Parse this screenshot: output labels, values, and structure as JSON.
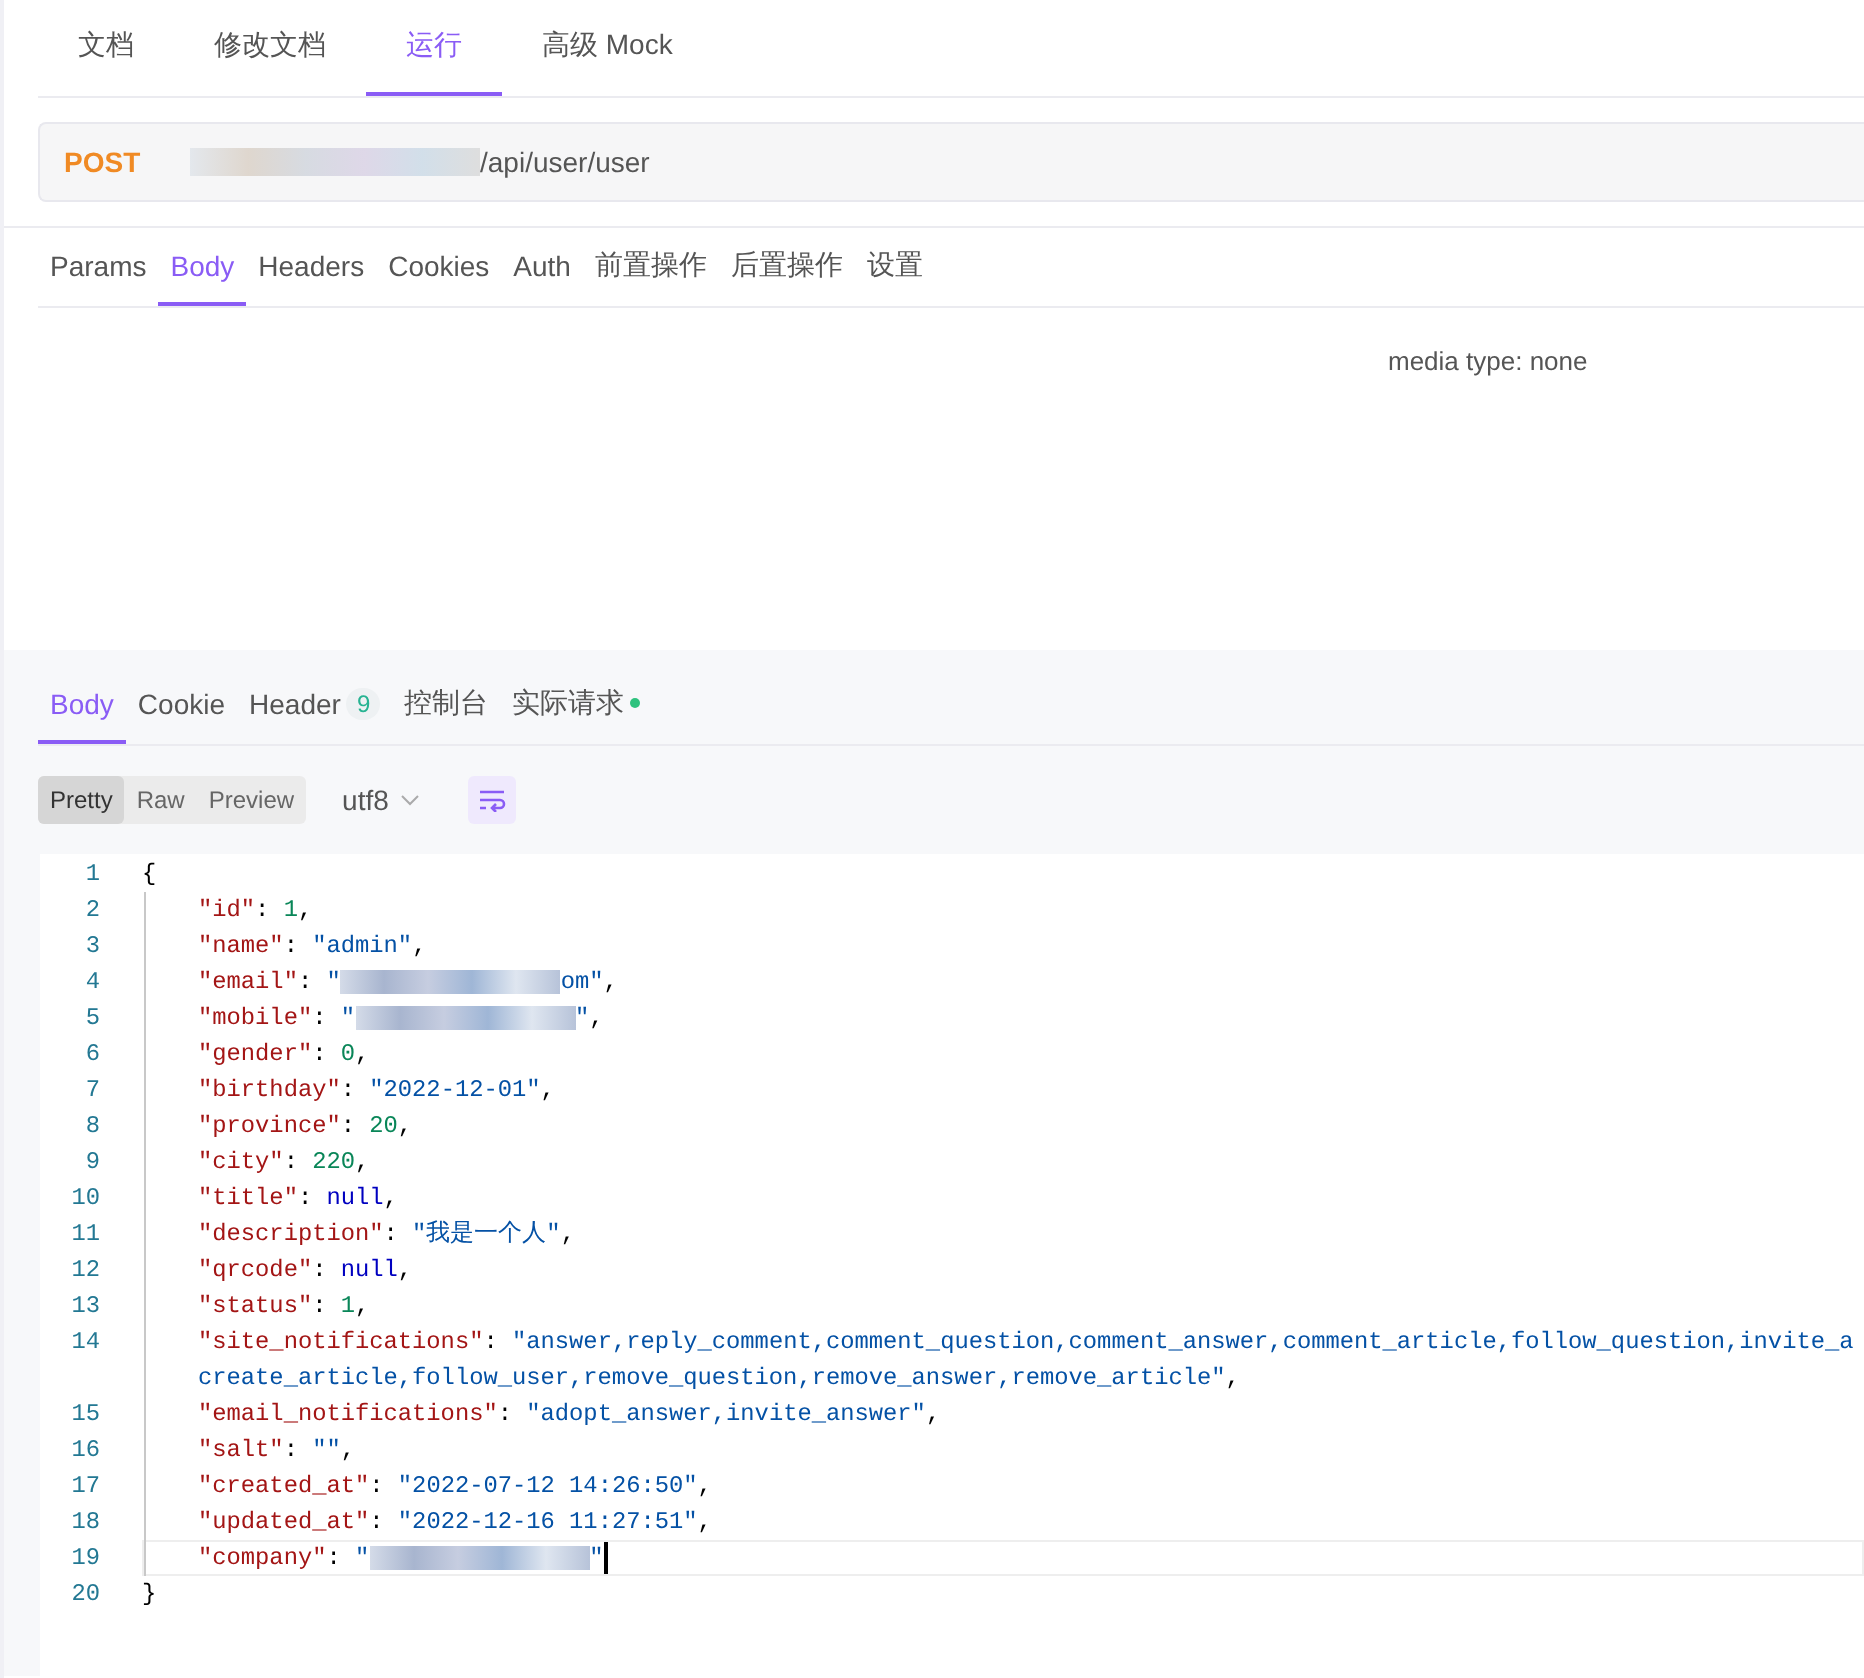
{
  "doc_tabs": [
    {
      "label": "文档",
      "selected": false
    },
    {
      "label": "修改文档",
      "selected": false
    },
    {
      "label": "运行",
      "selected": true
    },
    {
      "label": "高级 Mock",
      "selected": false
    }
  ],
  "request": {
    "method": "POST",
    "url_path": "/api/user/user"
  },
  "param_tabs": [
    {
      "label": "Params",
      "selected": false
    },
    {
      "label": "Body",
      "selected": true
    },
    {
      "label": "Headers",
      "selected": false
    },
    {
      "label": "Cookies",
      "selected": false
    },
    {
      "label": "Auth",
      "selected": false
    },
    {
      "label": "前置操作",
      "selected": false
    },
    {
      "label": "后置操作",
      "selected": false
    },
    {
      "label": "设置",
      "selected": false
    }
  ],
  "body_panel": {
    "media_type": "media type: none"
  },
  "response_tabs": [
    {
      "label": "Body",
      "selected": true,
      "dot": false
    },
    {
      "label": "Cookie",
      "selected": false,
      "dot": false
    },
    {
      "label": "Header",
      "selected": false,
      "badge": "9",
      "dot": false
    },
    {
      "label": "控制台",
      "selected": false,
      "dot": false
    },
    {
      "label": "实际请求",
      "selected": false,
      "dot": true
    }
  ],
  "view_modes": [
    {
      "label": "Pretty",
      "selected": true
    },
    {
      "label": "Raw",
      "selected": false
    },
    {
      "label": "Preview",
      "selected": false
    }
  ],
  "encoding": "utf8",
  "word_wrap": {
    "on": true
  },
  "code_lines": [
    {
      "number": "1",
      "indented": false,
      "current": false,
      "tokens": [
        {
          "kind": "brace",
          "text": "{"
        }
      ]
    },
    {
      "number": "2",
      "indented": true,
      "current": false,
      "tokens": [
        {
          "kind": "key",
          "text": "\"id\""
        },
        {
          "kind": "punct",
          "text": ": "
        },
        {
          "kind": "number",
          "text": "1"
        },
        {
          "kind": "punct",
          "text": ","
        }
      ]
    },
    {
      "number": "3",
      "indented": true,
      "current": false,
      "tokens": [
        {
          "kind": "key",
          "text": "\"name\""
        },
        {
          "kind": "punct",
          "text": ": "
        },
        {
          "kind": "string",
          "text": "\"admin\""
        },
        {
          "kind": "punct",
          "text": ","
        }
      ]
    },
    {
      "number": "4",
      "indented": true,
      "current": false,
      "tokens": [
        {
          "kind": "key",
          "text": "\"email\""
        },
        {
          "kind": "punct",
          "text": ": "
        },
        {
          "kind": "string",
          "text": "\""
        },
        {
          "kind": "redacted"
        },
        {
          "kind": "string",
          "text": "om\""
        },
        {
          "kind": "punct",
          "text": ","
        }
      ]
    },
    {
      "number": "5",
      "indented": true,
      "current": false,
      "tokens": [
        {
          "kind": "key",
          "text": "\"mobile\""
        },
        {
          "kind": "punct",
          "text": ": "
        },
        {
          "kind": "string",
          "text": "\""
        },
        {
          "kind": "redacted"
        },
        {
          "kind": "string",
          "text": "\""
        },
        {
          "kind": "punct",
          "text": ","
        }
      ]
    },
    {
      "number": "6",
      "indented": true,
      "current": false,
      "tokens": [
        {
          "kind": "key",
          "text": "\"gender\""
        },
        {
          "kind": "punct",
          "text": ": "
        },
        {
          "kind": "number",
          "text": "0"
        },
        {
          "kind": "punct",
          "text": ","
        }
      ]
    },
    {
      "number": "7",
      "indented": true,
      "current": false,
      "tokens": [
        {
          "kind": "key",
          "text": "\"birthday\""
        },
        {
          "kind": "punct",
          "text": ": "
        },
        {
          "kind": "string",
          "text": "\"2022-12-01\""
        },
        {
          "kind": "punct",
          "text": ","
        }
      ]
    },
    {
      "number": "8",
      "indented": true,
      "current": false,
      "tokens": [
        {
          "kind": "key",
          "text": "\"province\""
        },
        {
          "kind": "punct",
          "text": ": "
        },
        {
          "kind": "number",
          "text": "20"
        },
        {
          "kind": "punct",
          "text": ","
        }
      ]
    },
    {
      "number": "9",
      "indented": true,
      "current": false,
      "tokens": [
        {
          "kind": "key",
          "text": "\"city\""
        },
        {
          "kind": "punct",
          "text": ": "
        },
        {
          "kind": "number",
          "text": "220"
        },
        {
          "kind": "punct",
          "text": ","
        }
      ]
    },
    {
      "number": "10",
      "indented": true,
      "current": false,
      "tokens": [
        {
          "kind": "key",
          "text": "\"title\""
        },
        {
          "kind": "punct",
          "text": ": "
        },
        {
          "kind": "null",
          "text": "null"
        },
        {
          "kind": "punct",
          "text": ","
        }
      ]
    },
    {
      "number": "11",
      "indented": true,
      "current": false,
      "tokens": [
        {
          "kind": "key",
          "text": "\"description\""
        },
        {
          "kind": "punct",
          "text": ": "
        },
        {
          "kind": "string",
          "text": "\"我是一个人\""
        },
        {
          "kind": "punct",
          "text": ","
        }
      ]
    },
    {
      "number": "12",
      "indented": true,
      "current": false,
      "tokens": [
        {
          "kind": "key",
          "text": "\"qrcode\""
        },
        {
          "kind": "punct",
          "text": ": "
        },
        {
          "kind": "null",
          "text": "null"
        },
        {
          "kind": "punct",
          "text": ","
        }
      ]
    },
    {
      "number": "13",
      "indented": true,
      "current": false,
      "tokens": [
        {
          "kind": "key",
          "text": "\"status\""
        },
        {
          "kind": "punct",
          "text": ": "
        },
        {
          "kind": "number",
          "text": "1"
        },
        {
          "kind": "punct",
          "text": ","
        }
      ]
    },
    {
      "number": "14",
      "indented": true,
      "current": false,
      "tokens": [
        {
          "kind": "key",
          "text": "\"site_notifications\""
        },
        {
          "kind": "punct",
          "text": ": "
        },
        {
          "kind": "string",
          "text": "\"answer,reply_comment,comment_question,comment_answer,comment_article,follow_question,invite_a"
        }
      ]
    },
    {
      "indented": true,
      "current": false,
      "tokens": [
        {
          "kind": "string",
          "text": "create_article,follow_user,remove_question,remove_answer,remove_article\""
        },
        {
          "kind": "punct",
          "text": ","
        }
      ]
    },
    {
      "number": "15",
      "indented": true,
      "current": false,
      "tokens": [
        {
          "kind": "key",
          "text": "\"email_notifications\""
        },
        {
          "kind": "punct",
          "text": ": "
        },
        {
          "kind": "string",
          "text": "\"adopt_answer,invite_answer\""
        },
        {
          "kind": "punct",
          "text": ","
        }
      ]
    },
    {
      "number": "16",
      "indented": true,
      "current": false,
      "tokens": [
        {
          "kind": "key",
          "text": "\"salt\""
        },
        {
          "kind": "punct",
          "text": ": "
        },
        {
          "kind": "string",
          "text": "\"\""
        },
        {
          "kind": "punct",
          "text": ","
        }
      ]
    },
    {
      "number": "17",
      "indented": true,
      "current": false,
      "tokens": [
        {
          "kind": "key",
          "text": "\"created_at\""
        },
        {
          "kind": "punct",
          "text": ": "
        },
        {
          "kind": "string",
          "text": "\"2022-07-12 14:26:50\""
        },
        {
          "kind": "punct",
          "text": ","
        }
      ]
    },
    {
      "number": "18",
      "indented": true,
      "current": false,
      "tokens": [
        {
          "kind": "key",
          "text": "\"updated_at\""
        },
        {
          "kind": "punct",
          "text": ": "
        },
        {
          "kind": "string",
          "text": "\"2022-12-16 11:27:51\""
        },
        {
          "kind": "punct",
          "text": ","
        }
      ]
    },
    {
      "number": "19",
      "indented": true,
      "current": true,
      "tokens": [
        {
          "kind": "key",
          "text": "\"company\""
        },
        {
          "kind": "punct",
          "text": ": "
        },
        {
          "kind": "string",
          "text": "\""
        },
        {
          "kind": "redacted"
        },
        {
          "kind": "string",
          "text": "\""
        }
      ]
    },
    {
      "number": "20",
      "indented": false,
      "current": false,
      "tokens": [
        {
          "kind": "brace",
          "text": "}"
        }
      ]
    }
  ]
}
